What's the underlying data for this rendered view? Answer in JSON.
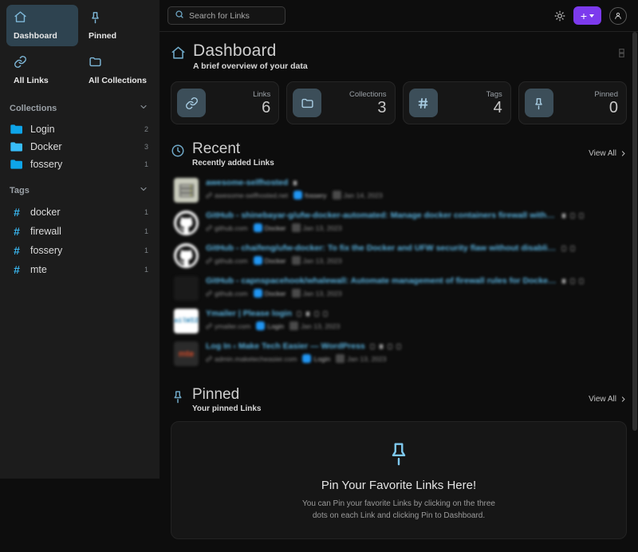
{
  "sidebar": {
    "quick_links": [
      {
        "label": "Dashboard",
        "icon": "home-icon",
        "active": true
      },
      {
        "label": "Pinned",
        "icon": "pin-icon",
        "active": false
      },
      {
        "label": "All Links",
        "icon": "link-icon",
        "active": false
      },
      {
        "label": "All Collections",
        "icon": "folder-icon",
        "active": false
      }
    ],
    "collections_header": "Collections",
    "collections": [
      {
        "label": "Login",
        "count": "2",
        "color": "#0ea5e9"
      },
      {
        "label": "Docker",
        "count": "3",
        "color": "#38bdf8"
      },
      {
        "label": "fossery",
        "count": "1",
        "color": "#0ea5e9"
      }
    ],
    "tags_header": "Tags",
    "tags": [
      {
        "label": "docker",
        "count": "1"
      },
      {
        "label": "firewall",
        "count": "1"
      },
      {
        "label": "fossery",
        "count": "1"
      },
      {
        "label": "mte",
        "count": "1"
      }
    ]
  },
  "topbar": {
    "search_placeholder": "Search for Links",
    "search_value": "",
    "theme_toggle": "sun-icon",
    "add_button": "+",
    "profile": "user-avatar"
  },
  "page": {
    "title": "Dashboard",
    "subtitle": "A brief overview of your data",
    "view_toggle": "list-view-icon"
  },
  "stats": [
    {
      "label": "Links",
      "value": "6",
      "icon": "link-icon"
    },
    {
      "label": "Collections",
      "value": "3",
      "icon": "folder-icon"
    },
    {
      "label": "Tags",
      "value": "4",
      "icon": "hash-icon"
    },
    {
      "label": "Pinned",
      "value": "0",
      "icon": "pin-icon"
    }
  ],
  "recent": {
    "title": "Recent",
    "subtitle": "Recently added Links",
    "view_all": "View All",
    "links": [
      {
        "title": "awesome-selfhosted",
        "host": "awesome-selfhosted.net",
        "collection": "fossery",
        "date": "Jan 14, 2023",
        "favicon": "srv",
        "favicon_text": "",
        "icons": 1
      },
      {
        "title": "GitHub - shinebayar-g/ufw-docker-automated: Manage docker containers firewall with UFW",
        "host": "github.com",
        "collection": "Docker",
        "date": "Jan 13, 2023",
        "favicon": "gh",
        "favicon_text": "",
        "icons": 3
      },
      {
        "title": "GitHub - chaifeng/ufw-docker: To fix the Docker and UFW security flaw without disabling iptables",
        "host": "github.com",
        "collection": "Docker",
        "date": "Jan 13, 2023",
        "favicon": "gh",
        "favicon_text": "",
        "icons": 2
      },
      {
        "title": "GitHub - capnspacehook/whalewall: Automate management of firewall rules for Docker con...",
        "host": "github.com",
        "collection": "Docker",
        "date": "Jan 13, 2023",
        "favicon": "blank",
        "favicon_text": "",
        "icons": 3
      },
      {
        "title": "Ymailer | Please login",
        "host": "ymailer.com",
        "collection": "Login",
        "date": "Jan 13, 2023",
        "favicon": "mw",
        "favicon_text": "MailWIZZ",
        "icons": 4
      },
      {
        "title": "Log In ‹ Make Tech Easier — WordPress",
        "host": "admin.maketecheasier.com",
        "collection": "Login",
        "date": "Jan 13, 2023",
        "favicon": "mte",
        "favicon_text": "mte",
        "icons": 4
      }
    ]
  },
  "pinned": {
    "title": "Pinned",
    "subtitle": "Your pinned Links",
    "view_all": "View All",
    "empty_title": "Pin Your Favorite Links Here!",
    "empty_line1": "You can Pin your favorite Links by clicking on the three",
    "empty_line2": "dots on each Link and clicking Pin to Dashboard."
  },
  "colors": {
    "accent_purple": "#7c3aed",
    "accent_blue": "#5ab3e0",
    "sidebar_bg": "#1c1c1c",
    "main_bg": "#0d0d0d",
    "active_tile": "#2e4350"
  }
}
